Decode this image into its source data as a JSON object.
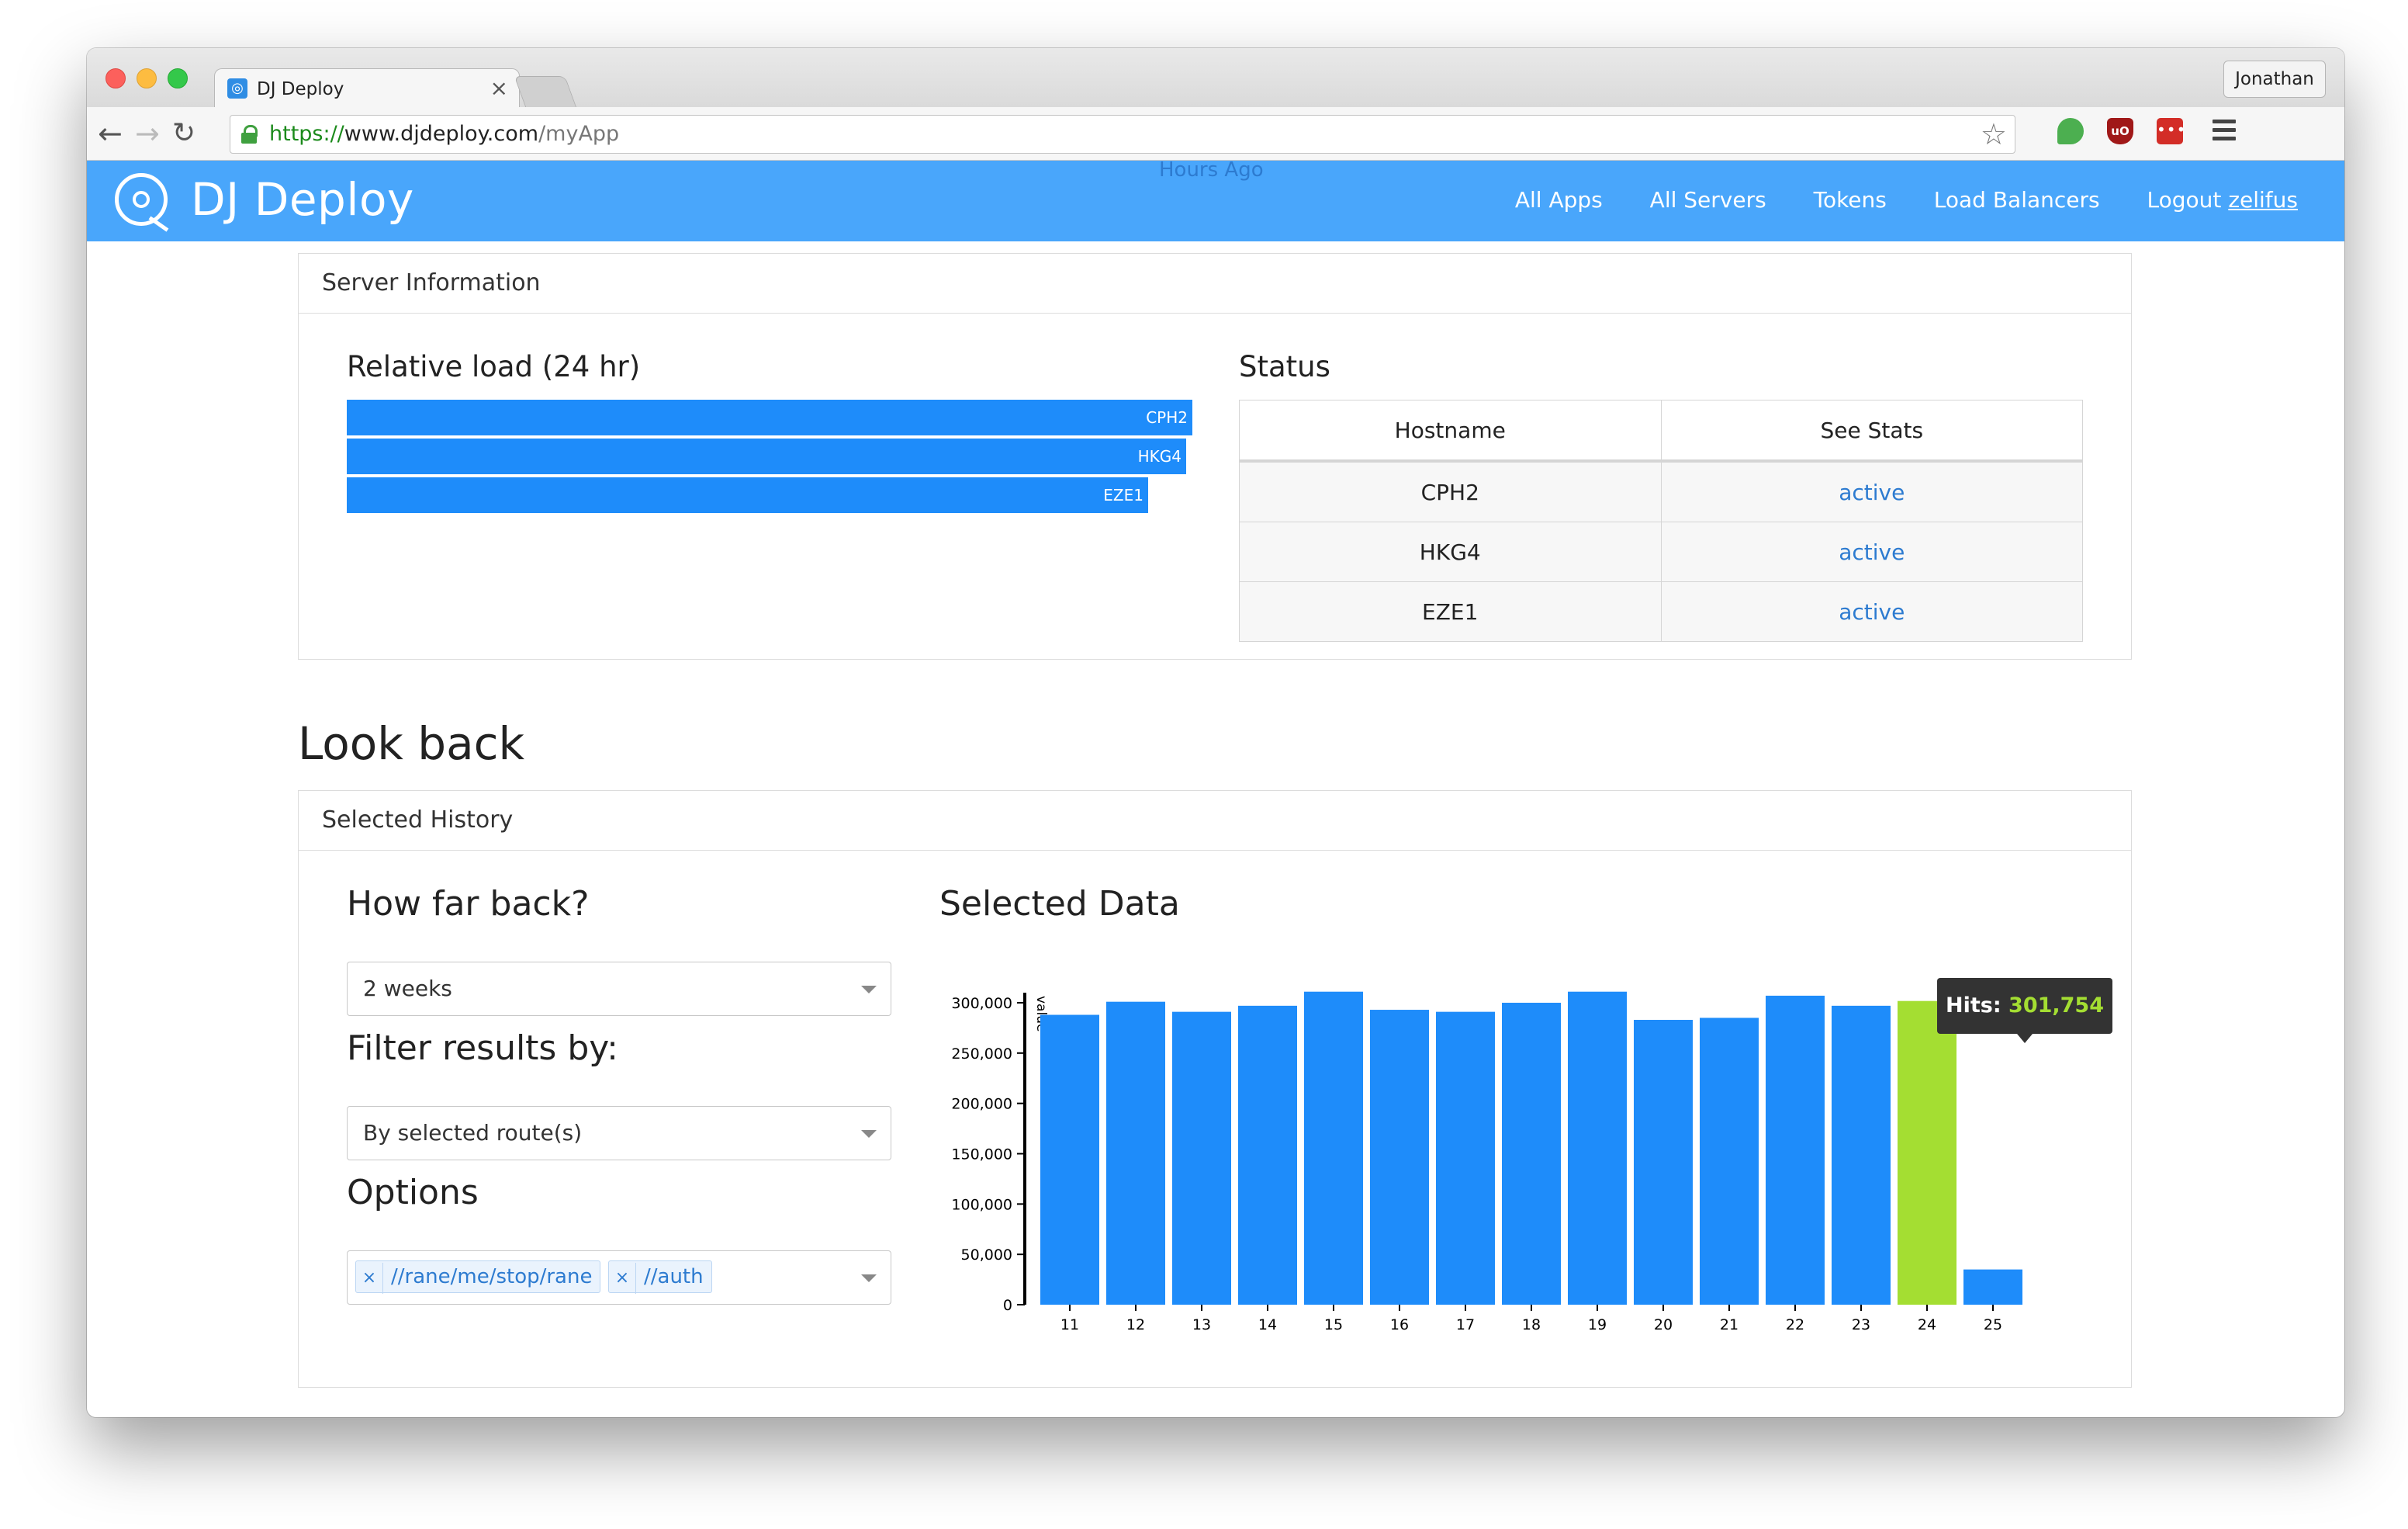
{
  "browser": {
    "tab_title": "DJ Deploy",
    "tab_close": "×",
    "profile": "Jonathan",
    "url_scheme": "https://",
    "url_host": "www.djdeploy.com",
    "url_path": "/myApp",
    "ext_ublock": "uO",
    "ext_lastpass": "•••"
  },
  "navbar": {
    "brand": "DJ Deploy",
    "links": [
      "All Apps",
      "All Servers",
      "Tokens",
      "Load Balancers"
    ],
    "logout": "Logout",
    "user": "zelifus",
    "color": "#49a6fb"
  },
  "overlay_text": "Hours Ago",
  "server_panel": {
    "heading": "Server Information",
    "load_title": "Relative load (24 hr)",
    "loads": [
      {
        "host": "CPH2",
        "value": 1.0
      },
      {
        "host": "HKG4",
        "value": 0.993
      },
      {
        "host": "EZE1",
        "value": 0.948
      }
    ],
    "status_title": "Status",
    "columns": [
      "Hostname",
      "See Stats"
    ],
    "rows": [
      {
        "host": "CPH2",
        "stat": "active"
      },
      {
        "host": "HKG4",
        "stat": "active"
      },
      {
        "host": "EZE1",
        "stat": "active"
      }
    ]
  },
  "lookback": {
    "title": "Look back",
    "heading": "Selected History",
    "how_far_label": "How far back?",
    "how_far_value": "2 weeks",
    "filter_label": "Filter results by:",
    "filter_value": "By selected route(s)",
    "options_label": "Options",
    "tag_remove": "×",
    "tags": [
      "//rane/me/stop/rane",
      "//auth"
    ],
    "chart_title": "Selected Data"
  },
  "tooltip": {
    "label": "Hits:",
    "value": "301,754"
  },
  "chart_data": {
    "type": "bar",
    "categories": [
      "11",
      "12",
      "13",
      "14",
      "15",
      "16",
      "17",
      "18",
      "19",
      "20",
      "21",
      "22",
      "23",
      "24",
      "25"
    ],
    "values": [
      288000,
      301000,
      291000,
      297000,
      311000,
      293000,
      291000,
      300000,
      311000,
      283000,
      285000,
      307000,
      297000,
      301754,
      35000
    ],
    "ylabel": "value",
    "ylim": [
      0,
      300000
    ],
    "yticks": [
      "0",
      "50,000",
      "100,000",
      "150,000",
      "200,000",
      "250,000",
      "300,000"
    ],
    "ytick_values": [
      0,
      50000,
      100000,
      150000,
      200000,
      250000,
      300000
    ],
    "highlight_category": "24",
    "bar_color": "#1e8cfa",
    "highlight_color": "#a4de32",
    "grid": false
  }
}
